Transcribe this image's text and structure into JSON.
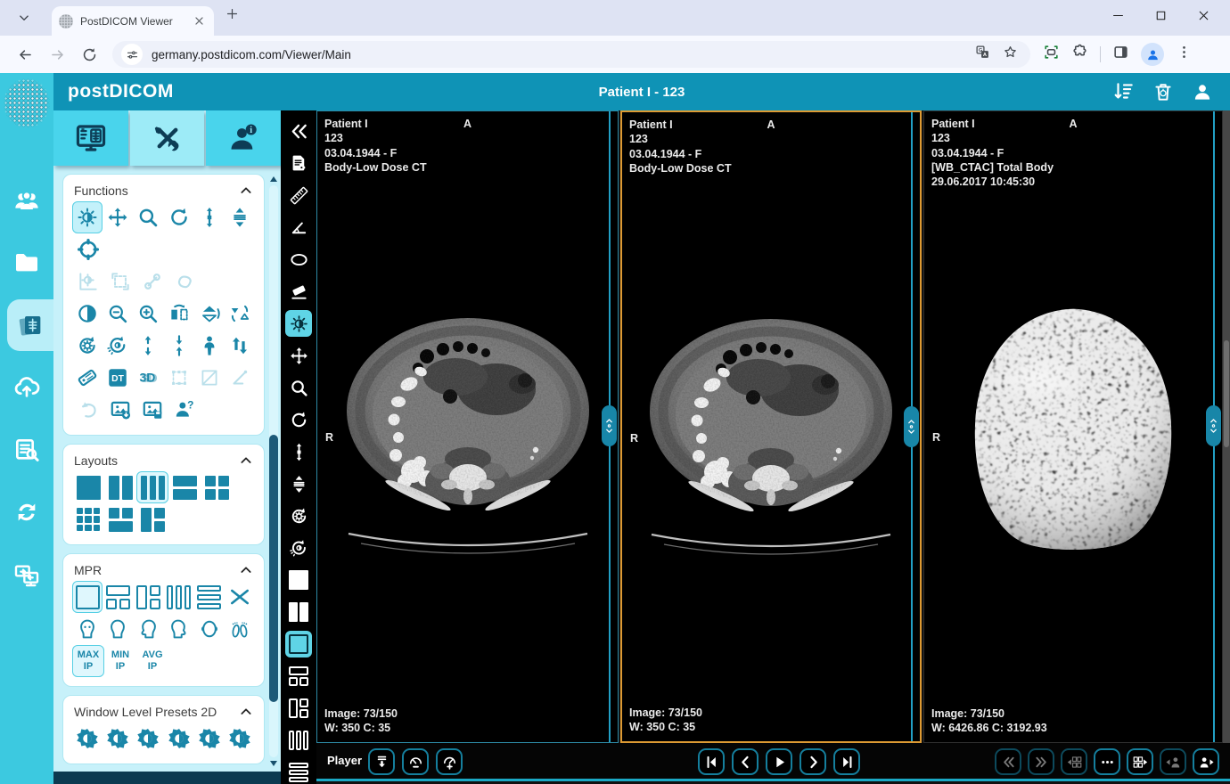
{
  "browser": {
    "tab_title": "PostDICOM Viewer",
    "url": "germany.postdicom.com/Viewer/Main",
    "nav": [
      {
        "icon": "back-arrow-icon",
        "enabled": true
      },
      {
        "icon": "forward-arrow-icon",
        "enabled": false
      },
      {
        "icon": "reload-icon",
        "enabled": true
      }
    ],
    "omnibox_icons": [
      {
        "icon": "translate-icon"
      },
      {
        "icon": "bookmark-star-icon"
      }
    ],
    "right_icons": [
      {
        "icon": "capture-icon"
      },
      {
        "icon": "extensions-puzzle-icon"
      },
      {
        "icon": "side-panel-icon"
      },
      {
        "icon": "profile-avatar-icon"
      },
      {
        "icon": "menu-kebab-icon"
      }
    ],
    "window_controls": [
      {
        "icon": "window-minimize-icon"
      },
      {
        "icon": "window-maximize-icon"
      },
      {
        "icon": "window-close-icon"
      }
    ]
  },
  "header": {
    "logo": "postDICOM",
    "title": "Patient I - 123",
    "actions": [
      {
        "icon": "sort-list-icon"
      },
      {
        "icon": "trash-icon"
      },
      {
        "icon": "account-icon"
      }
    ]
  },
  "sidebar": {
    "items": [
      {
        "icon": "users-icon",
        "active": false
      },
      {
        "icon": "folder-icon",
        "active": false
      },
      {
        "icon": "image-archive-icon",
        "active": true
      },
      {
        "icon": "cloud-upload-icon",
        "active": false
      },
      {
        "icon": "worklist-search-icon",
        "active": false
      },
      {
        "icon": "sync-icon",
        "active": false
      },
      {
        "icon": "remote-view-icon",
        "active": false
      }
    ]
  },
  "panel": {
    "tabs": [
      {
        "icon": "monitor-xray-icon",
        "active": false
      },
      {
        "icon": "tools-icon",
        "active": true
      },
      {
        "icon": "person-info-icon",
        "active": false
      }
    ],
    "functions": {
      "title": "Functions",
      "rows": [
        [
          {
            "icon": "window-level-icon",
            "state": "active"
          },
          {
            "icon": "pan-icon"
          },
          {
            "icon": "zoom-icon"
          },
          {
            "icon": "rotate-icon"
          },
          {
            "icon": "scroll-vertical-icon"
          },
          {
            "icon": "stack-scroll-icon"
          }
        ],
        [
          {
            "icon": "localizer-icon"
          }
        ],
        [
          {
            "icon": "window-level-roi-icon",
            "state": "disabled"
          },
          {
            "icon": "window-region-icon",
            "state": "disabled"
          },
          {
            "icon": "probe-icon",
            "state": "disabled"
          },
          {
            "icon": "freehand-roi-icon",
            "state": "disabled"
          }
        ],
        [
          {
            "icon": "invert-icon"
          },
          {
            "icon": "zoom-out-icon"
          },
          {
            "icon": "zoom-in-icon"
          },
          {
            "icon": "flip-horizontal-icon"
          },
          {
            "icon": "flip-vertical-icon"
          },
          {
            "icon": "rotate-flip-icon"
          }
        ],
        [
          {
            "icon": "reset-icon"
          },
          {
            "icon": "reset-window-level-icon"
          },
          {
            "icon": "expand-vertical-icon"
          },
          {
            "icon": "collapse-vertical-icon"
          },
          {
            "icon": "fit-patient-icon"
          },
          {
            "icon": "swap-updown-icon"
          }
        ],
        [
          {
            "icon": "tag-icon"
          },
          {
            "icon": "dicom-tags-icon"
          },
          {
            "icon": "three-d-icon"
          },
          {
            "icon": "selection-box-icon",
            "state": "disabled"
          },
          {
            "icon": "crop-icon",
            "state": "disabled"
          },
          {
            "icon": "angle-probe-icon",
            "state": "disabled"
          }
        ],
        [
          {
            "icon": "undo-icon",
            "state": "disabled"
          },
          {
            "icon": "image-download-icon"
          },
          {
            "icon": "image-save-icon"
          },
          {
            "icon": "patient-question-icon"
          }
        ]
      ]
    },
    "layouts": {
      "title": "Layouts",
      "items": [
        {
          "layout": "1x1"
        },
        {
          "layout": "1x2"
        },
        {
          "layout": "1x3",
          "selected": true
        },
        {
          "layout": "2x1"
        },
        {
          "layout": "2x2"
        },
        {
          "layout": "3x3"
        },
        {
          "layout": "top2-bottom1"
        },
        {
          "layout": "left1-right2"
        }
      ]
    },
    "mpr": {
      "title": "MPR",
      "layouts": [
        {
          "layout": "single",
          "selected": true
        },
        {
          "layout": "top1-bottom2"
        },
        {
          "layout": "left1-right2"
        },
        {
          "layout": "3col"
        },
        {
          "layout": "3row"
        },
        {
          "icon": "oblique-x-icon"
        }
      ],
      "orientations": [
        {
          "icon": "face-front-icon"
        },
        {
          "icon": "head-front-icon"
        },
        {
          "icon": "head-left-icon"
        },
        {
          "icon": "head-right-icon"
        },
        {
          "icon": "head-top-icon"
        },
        {
          "icon": "feet-icon"
        }
      ],
      "projections": [
        {
          "line1": "MAX",
          "line2": "IP",
          "selected": true
        },
        {
          "line1": "MIN",
          "line2": "IP",
          "selected": false
        },
        {
          "line1": "AVG",
          "line2": "IP",
          "selected": false
        }
      ]
    },
    "wl_presets": {
      "title": "Window Level Presets 2D",
      "items": [
        {
          "icon": "wl-preset-icon"
        },
        {
          "icon": "wl-preset-icon"
        },
        {
          "icon": "wl-preset-icon"
        },
        {
          "icon": "wl-preset-icon"
        },
        {
          "icon": "wl-preset-icon"
        },
        {
          "icon": "wl-preset-icon"
        }
      ]
    }
  },
  "toolbar": {
    "items": [
      {
        "icon": "collapse-panel-icon"
      },
      {
        "icon": "report-view-icon"
      },
      {
        "icon": "ruler-icon"
      },
      {
        "icon": "angle-icon"
      },
      {
        "icon": "ellipse-icon"
      },
      {
        "icon": "eraser-icon"
      },
      {
        "icon": "window-level-icon",
        "active": true
      },
      {
        "icon": "pan-icon"
      },
      {
        "icon": "zoom-icon"
      },
      {
        "icon": "rotate-icon"
      },
      {
        "icon": "scroll-vertical-icon"
      },
      {
        "icon": "stack-scroll-icon"
      },
      {
        "icon": "reset-icon"
      },
      {
        "icon": "reset-window-level-icon"
      },
      {
        "layout": "1x1"
      },
      {
        "layout": "1x2"
      },
      {
        "layout": "single",
        "active": true,
        "outline": true
      },
      {
        "layout": "top1-bottom2",
        "outline": true
      },
      {
        "layout": "left1-right2",
        "outline": true
      },
      {
        "layout": "3col",
        "outline": true
      },
      {
        "layout": "3row",
        "outline": true
      }
    ]
  },
  "viewports": [
    {
      "selected": false,
      "modality": "ct",
      "info_lines": [
        "Patient I",
        "123",
        "03.04.1944 - F",
        "Body-Low Dose CT"
      ],
      "orientation_top": "A",
      "orientation_left": "R",
      "image_counter": "Image: 73/150",
      "window_level": "W: 350 C: 35"
    },
    {
      "selected": true,
      "modality": "ct",
      "info_lines": [
        "Patient I",
        "123",
        "03.04.1944 - F",
        "Body-Low Dose CT"
      ],
      "orientation_top": "A",
      "orientation_left": "R",
      "image_counter": "Image: 73/150",
      "window_level": "W: 350 C: 35"
    },
    {
      "selected": false,
      "modality": "pet",
      "info_lines": [
        "Patient I",
        "123",
        "03.04.1944 - F",
        "[WB_CTAC] Total Body",
        "29.06.2017 10:45:30"
      ],
      "orientation_top": "A",
      "orientation_left": "R",
      "image_counter": "Image: 73/150",
      "window_level": "W: 6426.86 C: 3192.93"
    }
  ],
  "player": {
    "label": "Player",
    "cine_buttons": [
      {
        "icon": "cine-export-icon"
      },
      {
        "icon": "speed-down-icon"
      },
      {
        "icon": "speed-up-icon"
      }
    ],
    "nav_buttons": [
      {
        "icon": "first-image-icon"
      },
      {
        "icon": "previous-image-icon"
      },
      {
        "icon": "play-icon"
      },
      {
        "icon": "next-image-icon"
      },
      {
        "icon": "last-image-icon"
      }
    ],
    "series_buttons": [
      {
        "icon": "previous-series-icon",
        "enabled": false
      },
      {
        "icon": "next-series-icon",
        "enabled": false
      },
      {
        "icon": "previous-layout-icon",
        "enabled": false
      },
      {
        "icon": "more-options-icon",
        "enabled": true
      },
      {
        "icon": "next-layout-icon",
        "enabled": true
      },
      {
        "icon": "previous-patient-icon",
        "enabled": false
      },
      {
        "icon": "next-patient-icon",
        "enabled": true
      }
    ]
  },
  "colors": {
    "accent": "#0f93b6",
    "sidebar": "#3cc9e0",
    "panel_bg": "#c7f1fa",
    "icon_teal": "#1a86a8",
    "active_cyan": "#5fd4e6",
    "selected_border": "#dd9a33",
    "toolbar_bg": "#000000"
  }
}
